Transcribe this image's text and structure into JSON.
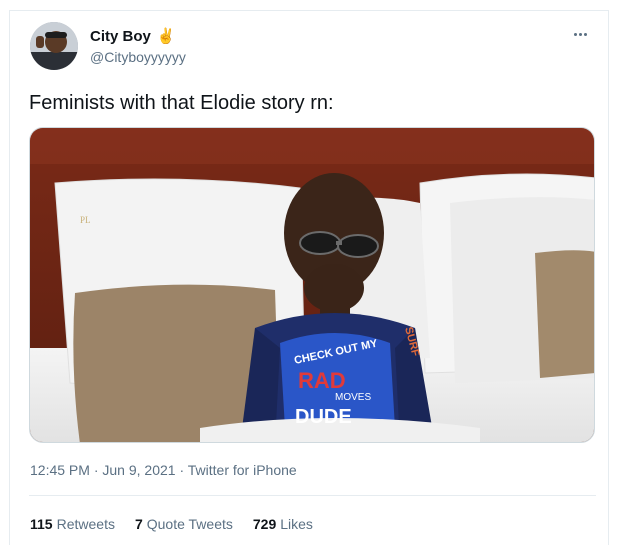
{
  "tweet": {
    "author_name": "City Boy",
    "author_emoji": "✌",
    "author_handle": "@Cityboyyyyyy",
    "text": "Feminists with that Elodie story rn:",
    "time": "12:45 PM",
    "date": "Jun 9, 2021",
    "source": "Twitter for iPhone",
    "separator": " · "
  },
  "stats": {
    "retweets_count": "115",
    "retweets_label": "Retweets",
    "quotes_count": "7",
    "quotes_label": "Quote Tweets",
    "likes_count": "729",
    "likes_label": "Likes"
  },
  "media": {
    "shirt_lines": [
      "CHECK OUT MY",
      "RAD",
      "MOVES",
      "DUDE"
    ],
    "side_text": "SURF",
    "logo_text": "PL"
  },
  "colors": {
    "primary_text": "#0f1419",
    "secondary_text": "#5b7083",
    "border": "#e6ecf0"
  }
}
